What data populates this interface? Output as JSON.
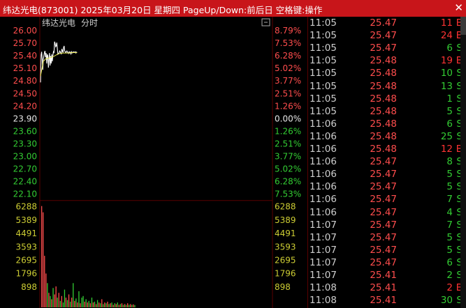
{
  "window": {
    "title": "纬达光电(873001) 2025年03月20日 星期四 PageUp/Down:前后日 空格键:操作",
    "close_glyph": "✕"
  },
  "chart_header": {
    "stock_name": "纬达光电",
    "mode_label": "分时"
  },
  "colors": {
    "up": "#ff4d4d",
    "down": "#33cc33",
    "neutral": "#e6e6e6",
    "volume_axis": "#cccc33",
    "price_line": "#ffffff",
    "avg_line": "#e6e64d",
    "grid": "#5a0000",
    "buy": "#ff3333",
    "sell": "#33cc33"
  },
  "chart_data": {
    "type": "line",
    "title": "纬达光电  分时",
    "prev_close": 23.9,
    "price_ticks": [
      "26.00",
      "25.70",
      "25.40",
      "25.10",
      "24.80",
      "24.50",
      "24.20",
      "23.90",
      "23.60",
      "23.30",
      "23.00",
      "22.70",
      "22.40",
      "22.10"
    ],
    "price_range": [
      21.95,
      26.05
    ],
    "pct_ticks": [
      "8.79%",
      "7.53%",
      "6.28%",
      "5.02%",
      "3.77%",
      "2.51%",
      "1.26%",
      "0.00%",
      "1.26%",
      "2.51%",
      "3.77%",
      "5.02%",
      "6.28%",
      "7.53%"
    ],
    "volume_ticks": [
      "6288",
      "5389",
      "4491",
      "3593",
      "2695",
      "1796",
      "898"
    ],
    "volume_max": 6288,
    "price_series": {
      "name": "price",
      "x_minutes": [
        0,
        1,
        2,
        3,
        4,
        5,
        6,
        7,
        8,
        9,
        10,
        11,
        12,
        13,
        14,
        15,
        16,
        17,
        18,
        19,
        20,
        21,
        22,
        23,
        24,
        25,
        26,
        27,
        28,
        29,
        30,
        31,
        32,
        33,
        34,
        35,
        36,
        37,
        38,
        39,
        40,
        41,
        42,
        43,
        44,
        45,
        46,
        47,
        48,
        49,
        50,
        51,
        52,
        53,
        54,
        55,
        56,
        57,
        58,
        59,
        60,
        61,
        62,
        63,
        64,
        65
      ],
      "values": [
        24.75,
        25.4,
        25.48,
        25.3,
        25.05,
        25.3,
        25.38,
        25.46,
        25.5,
        25.35,
        25.45,
        25.2,
        25.42,
        25.38,
        25.1,
        25.3,
        25.45,
        25.15,
        25.38,
        25.2,
        25.42,
        25.25,
        25.4,
        25.48,
        25.45,
        25.72,
        25.68,
        25.6,
        25.62,
        25.7,
        25.55,
        25.42,
        25.44,
        25.45,
        25.5,
        25.48,
        25.44,
        25.43,
        25.55,
        25.5,
        25.46,
        25.58,
        25.62,
        25.5,
        25.48,
        25.46,
        25.48,
        25.5,
        25.47,
        25.46,
        25.44,
        25.48,
        25.45,
        25.47,
        25.43,
        25.48,
        25.45,
        25.47,
        25.46,
        25.48,
        25.47,
        25.46,
        25.48,
        25.45,
        25.47,
        25.46
      ]
    },
    "avg_series": {
      "name": "average",
      "x_minutes": [
        0,
        5,
        10,
        15,
        20,
        25,
        30,
        35,
        40,
        45,
        50,
        55,
        60,
        65
      ],
      "values": [
        24.9,
        25.25,
        25.32,
        25.33,
        25.35,
        25.38,
        25.42,
        25.44,
        25.45,
        25.45,
        25.45,
        25.46,
        25.46,
        25.46
      ]
    },
    "volume_series": {
      "name": "volume",
      "values": [
        6288,
        5900,
        3200,
        2100,
        1500,
        900,
        700,
        500,
        1200,
        800,
        1300,
        600,
        900,
        400,
        700,
        300,
        1100,
        600,
        450,
        800,
        350,
        600,
        1500,
        400,
        550,
        300,
        1000,
        250,
        600,
        700,
        350,
        500,
        300,
        400,
        250,
        600,
        300,
        350,
        200,
        450,
        300,
        250,
        500,
        200,
        300,
        250,
        350,
        200,
        250,
        300,
        150,
        250,
        200,
        300,
        150,
        200,
        250,
        150,
        200,
        150,
        250,
        150,
        200,
        150,
        180,
        140
      ],
      "colors": [
        "up",
        "up",
        "up",
        "up",
        "down",
        "up",
        "down",
        "up",
        "down",
        "up",
        "up",
        "down",
        "up",
        "down",
        "up",
        "down",
        "down",
        "up",
        "down",
        "up",
        "down",
        "up",
        "down",
        "up",
        "down",
        "up",
        "down",
        "up",
        "down",
        "down",
        "up",
        "down",
        "up",
        "down",
        "up",
        "down",
        "up",
        "down",
        "up",
        "down",
        "up",
        "down",
        "up",
        "down",
        "up",
        "down",
        "up",
        "down",
        "up",
        "down",
        "up",
        "down",
        "up",
        "down",
        "up",
        "down",
        "up",
        "down",
        "up",
        "down",
        "up",
        "down",
        "up",
        "down",
        "up",
        "down"
      ]
    }
  },
  "ticks": [
    {
      "time": "11:05",
      "price": "25.47",
      "volume": "11",
      "side": "B"
    },
    {
      "time": "11:05",
      "price": "25.47",
      "volume": "24",
      "side": "B"
    },
    {
      "time": "11:05",
      "price": "25.47",
      "volume": "6",
      "side": "S"
    },
    {
      "time": "11:05",
      "price": "25.48",
      "volume": "19",
      "side": "B"
    },
    {
      "time": "11:05",
      "price": "25.48",
      "volume": "10",
      "side": "S"
    },
    {
      "time": "11:05",
      "price": "25.48",
      "volume": "13",
      "side": "S"
    },
    {
      "time": "11:05",
      "price": "25.48",
      "volume": "1",
      "side": "S"
    },
    {
      "time": "11:05",
      "price": "25.48",
      "volume": "5",
      "side": "S"
    },
    {
      "time": "11:06",
      "price": "25.48",
      "volume": "6",
      "side": "S"
    },
    {
      "time": "11:06",
      "price": "25.48",
      "volume": "25",
      "side": "S"
    },
    {
      "time": "11:06",
      "price": "25.48",
      "volume": "12",
      "side": "B"
    },
    {
      "time": "11:06",
      "price": "25.47",
      "volume": "8",
      "side": "S"
    },
    {
      "time": "11:06",
      "price": "25.47",
      "volume": "5",
      "side": "S"
    },
    {
      "time": "11:06",
      "price": "25.47",
      "volume": "5",
      "side": "S"
    },
    {
      "time": "11:06",
      "price": "25.47",
      "volume": "7",
      "side": "S"
    },
    {
      "time": "11:06",
      "price": "25.47",
      "volume": "4",
      "side": "S"
    },
    {
      "time": "11:07",
      "price": "25.47",
      "volume": "7",
      "side": "S"
    },
    {
      "time": "11:07",
      "price": "25.47",
      "volume": "5",
      "side": "S"
    },
    {
      "time": "11:07",
      "price": "25.47",
      "volume": "5",
      "side": "S"
    },
    {
      "time": "11:07",
      "price": "25.47",
      "volume": "6",
      "side": "S"
    },
    {
      "time": "11:07",
      "price": "25.41",
      "volume": "2",
      "side": "S"
    },
    {
      "time": "11:08",
      "price": "25.41",
      "volume": "2",
      "side": "B"
    },
    {
      "time": "11:08",
      "price": "25.41",
      "volume": "30",
      "side": "S"
    }
  ]
}
